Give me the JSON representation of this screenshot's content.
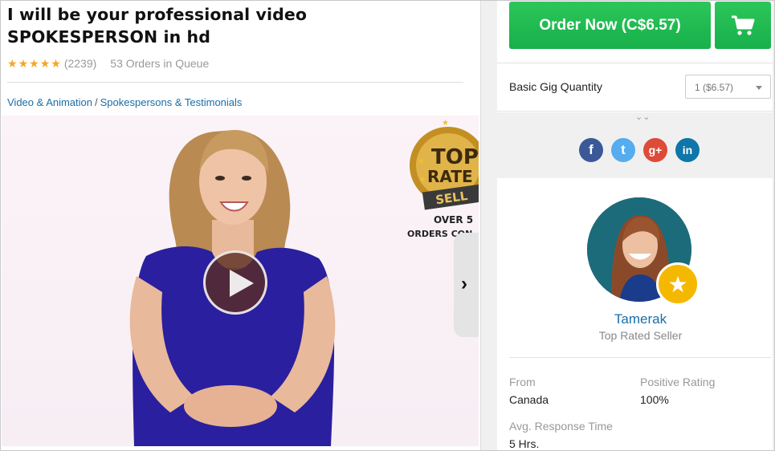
{
  "gig": {
    "title": "I will be your professional video SPOKESPERSON in hd",
    "rating_count": "(2239)",
    "orders_in_queue": "53 Orders in Queue",
    "stars": 5,
    "breadcrumb": [
      "Video & Animation",
      "Spokespersons & Testimonials"
    ],
    "breadcrumb_sep": "/"
  },
  "video": {
    "badge_over": "OVER 5",
    "badge_orders": "ORDERS CON",
    "badge_top": "TOP",
    "badge_rated": "RATE",
    "badge_seller": "SELL"
  },
  "order": {
    "button_label": "Order Now (C$6.57)",
    "quantity_label": "Basic Gig Quantity",
    "quantity_value": "1 ($6.57)",
    "expand_glyph": "⌄⌄"
  },
  "social": {
    "facebook": "f",
    "twitter": "t",
    "googleplus": "g+",
    "linkedin": "in"
  },
  "seller": {
    "name": "Tamerak",
    "level": "Top Rated Seller",
    "stats": [
      {
        "label": "From",
        "value": "Canada"
      },
      {
        "label": "Positive Rating",
        "value": "100%"
      },
      {
        "label": "Avg. Response Time",
        "value": "5 Hrs."
      }
    ]
  },
  "colors": {
    "accent_green": "#1dbf50",
    "link_blue": "#1a6eaa",
    "star_gold": "#f5a623"
  }
}
